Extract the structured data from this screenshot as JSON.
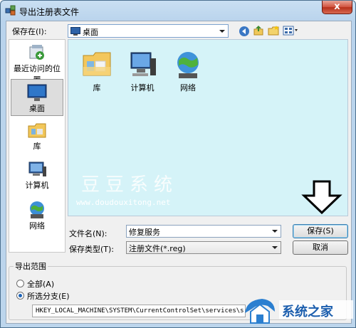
{
  "window": {
    "title": "导出注册表文件",
    "close_label": "x"
  },
  "toolbar": {
    "save_in_label": "保存在(I):",
    "location": "桌面"
  },
  "places": [
    {
      "label": "最近访问的位置"
    },
    {
      "label": "桌面"
    },
    {
      "label": "库"
    },
    {
      "label": "计算机"
    },
    {
      "label": "网络"
    }
  ],
  "files": [
    {
      "label": "库"
    },
    {
      "label": "计算机"
    },
    {
      "label": "网络"
    }
  ],
  "watermark": {
    "text": "豆豆系统",
    "url": "www.doudouxitong.net"
  },
  "form": {
    "filename_label": "文件名(N):",
    "filename_value": "修复服务",
    "filetype_label": "保存类型(T):",
    "filetype_value": "注册文件(*.reg)",
    "save_button": "保存(S)",
    "cancel_button": "取消"
  },
  "export_range": {
    "title": "导出范围",
    "option_all": "全部(A)",
    "option_selected": "所选分支(E)",
    "selected": "option_selected",
    "branch_path": "HKEY_LOCAL_MACHINE\\SYSTEM\\CurrentControlSet\\services\\s"
  },
  "corner_logo": {
    "text": "系统之家"
  },
  "colors": {
    "file_area_bg": "#d5f3f8",
    "window_frame": "#bcd5ec",
    "close_button": "#c8432d"
  }
}
